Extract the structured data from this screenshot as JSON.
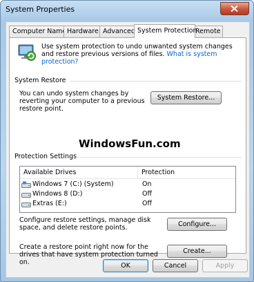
{
  "window": {
    "title": "System Properties"
  },
  "tabs": [
    {
      "label": "Computer Name"
    },
    {
      "label": "Hardware"
    },
    {
      "label": "Advanced"
    },
    {
      "label": "System Protection"
    },
    {
      "label": "Remote"
    }
  ],
  "intro": {
    "text": "Use system protection to undo unwanted system changes and restore previous versions of files.",
    "link": "What is system protection?"
  },
  "system_restore": {
    "heading": "System Restore",
    "description": "You can undo system changes by reverting your computer to a previous restore point.",
    "button": "System Restore..."
  },
  "watermark": "WindowsFun.com",
  "protection": {
    "heading": "Protection Settings",
    "columns": [
      "Available Drives",
      "Protection"
    ],
    "rows": [
      {
        "drive": "Windows 7 (C:) (System)",
        "protection": "On",
        "icon": "system-drive-icon"
      },
      {
        "drive": "Windows 8 (D:)",
        "protection": "Off",
        "icon": "drive-icon"
      },
      {
        "drive": "Extras (E:)",
        "protection": "Off",
        "icon": "drive-icon"
      }
    ],
    "configure_text": "Configure restore settings, manage disk space, and delete restore points.",
    "configure_button": "Configure...",
    "create_text": "Create a restore point right now for the drives that have system protection turned on.",
    "create_button": "Create..."
  },
  "footer": {
    "ok": "OK",
    "cancel": "Cancel",
    "apply": "Apply"
  },
  "colors": {
    "link": "#0066cc",
    "titlebar": "#b9d6ee",
    "close": "#c7563e"
  }
}
